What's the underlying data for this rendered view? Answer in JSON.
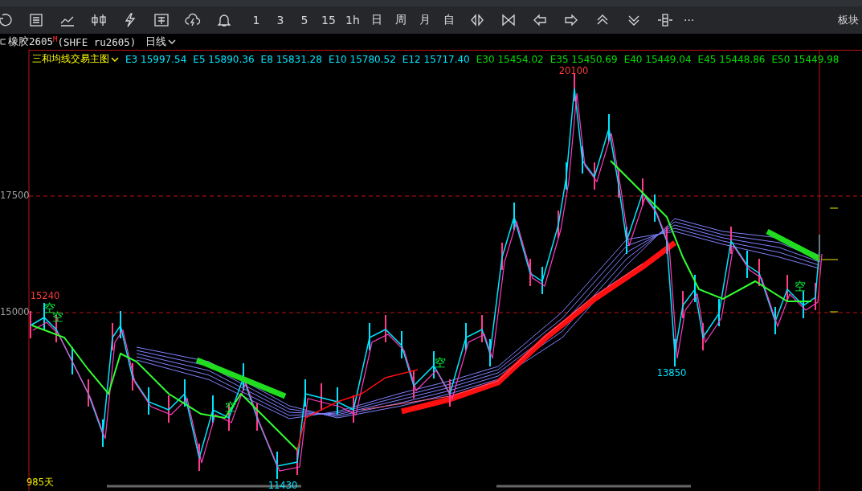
{
  "toolbar": {
    "periods": [
      "1",
      "3",
      "5",
      "15",
      "1h",
      "日",
      "周",
      "月",
      "自"
    ],
    "more": "···",
    "panel_button": "板块"
  },
  "symbol_bar": {
    "name": "橡胶2605",
    "mark": "M",
    "code": "(SHFE ru2605)",
    "period": "日线"
  },
  "chart": {
    "indicator": "三和均线交易主图",
    "averages": [
      {
        "label": "E3 15997.54",
        "color": "#00e5ff"
      },
      {
        "label": "E5 15890.36",
        "color": "#00e5ff"
      },
      {
        "label": "E8 15831.28",
        "color": "#00e5ff"
      },
      {
        "label": "E10 15780.52",
        "color": "#00e5ff"
      },
      {
        "label": "E12 15717.40",
        "color": "#00e5ff"
      },
      {
        "label": "E30 15454.02",
        "color": "#00e000"
      },
      {
        "label": "E35 15450.69",
        "color": "#00e000"
      },
      {
        "label": "E40 15449.04",
        "color": "#00e000"
      },
      {
        "label": "E45 15448.86",
        "color": "#00e000"
      },
      {
        "label": "E50 15449.98",
        "color": "#00e000"
      }
    ],
    "price_axis": [
      "17500",
      "15000"
    ],
    "annotations": [
      {
        "text": "20100",
        "color": "#ff3b3b"
      },
      {
        "text": "15240",
        "color": "#ff3b3b"
      },
      {
        "text": "13850",
        "color": "#00e5ff"
      },
      {
        "text": "11430",
        "color": "#00e5ff"
      },
      {
        "text": "985天",
        "color": "#e8e800"
      }
    ],
    "signals": [
      "空",
      "空",
      "空",
      "空",
      "空"
    ]
  }
}
